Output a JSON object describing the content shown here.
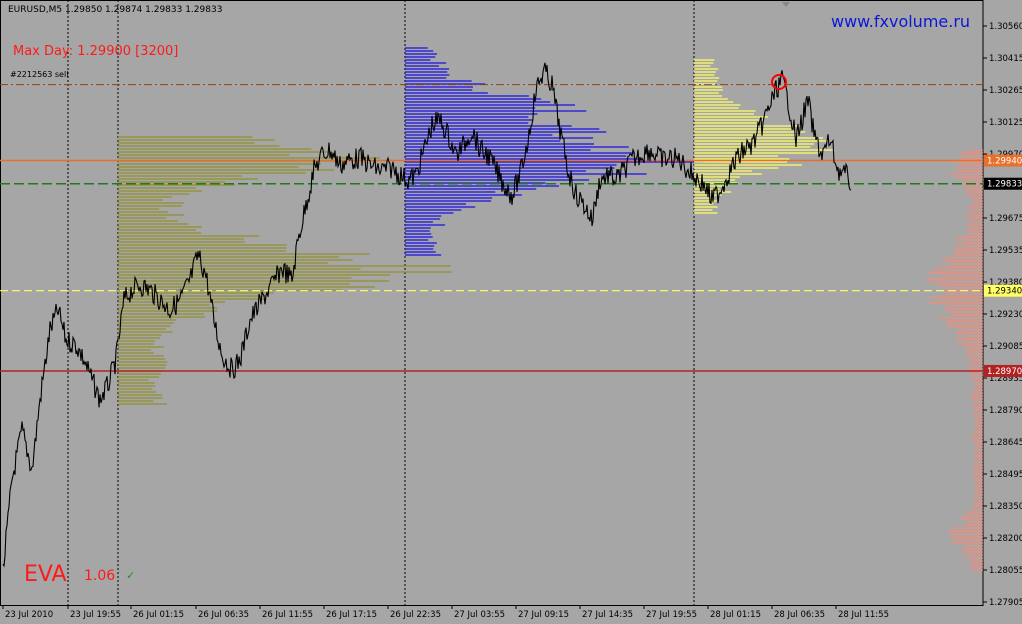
{
  "header": {
    "symbol_line": "EURUSD,M5  1.29850 1.29874 1.29833 1.29833",
    "max_day": "Max Day: 1.29900 [3200]",
    "order_label": "#2212563 sell",
    "site_url": "www.fxvolume.ru"
  },
  "watermark": {
    "eva_text": "EVA",
    "eva_version": "1.06",
    "eva_check": "✓"
  },
  "colors": {
    "background": "#a6a6a6",
    "profile_olive": "#8f8f2f",
    "profile_blue": "#1a10e6",
    "profile_yellow": "#ffff66",
    "profile_salmon": "#f28c7a",
    "line_orange": "#e8702a",
    "line_green": "#1f7a1f",
    "line_red": "#b22222",
    "line_yellow": "#ffff66",
    "line_dashdot": "#8b4513"
  },
  "price_axis": {
    "labels": [
      "1.30560",
      "1.30415",
      "1.30265",
      "1.30125",
      "1.29970",
      "1.29833",
      "1.29675",
      "1.29535",
      "1.29380",
      "1.29230",
      "1.29085",
      "1.28935",
      "1.28790",
      "1.28645",
      "1.28495",
      "1.28350",
      "1.28200",
      "1.28055",
      "1.27905"
    ],
    "markers": [
      {
        "text": "1.29940",
        "price": 1.2994,
        "color": "#e8702a"
      },
      {
        "text": "1.29833",
        "price": 1.29833,
        "color": "#000000"
      },
      {
        "text": "1.29340",
        "price": 1.2934,
        "color": "#ffff66"
      },
      {
        "text": "1.28970",
        "price": 1.2897,
        "color": "#b22222"
      }
    ]
  },
  "time_axis": {
    "labels": [
      "23 Jul 2010",
      "23 Jul 19:55",
      "26 Jul 01:15",
      "26 Jul 06:35",
      "26 Jul 11:55",
      "26 Jul 17:15",
      "26 Jul 22:35",
      "27 Jul 03:55",
      "27 Jul 09:15",
      "27 Jul 14:35",
      "27 Jul 19:55",
      "28 Jul 01:15",
      "28 Jul 06:35",
      "28 Jul 11:55"
    ]
  },
  "levels": {
    "max_day_price": 1.299,
    "max_day_volume": 3200,
    "orange": 1.2994,
    "current": 1.29833,
    "yellow": 1.2934,
    "red": 1.2897,
    "dashdot": 1.3029
  }
}
